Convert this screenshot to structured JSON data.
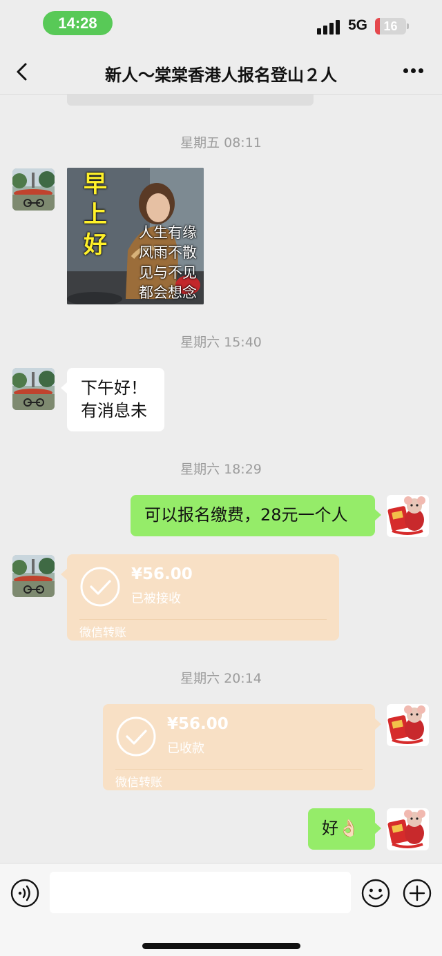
{
  "status_bar": {
    "time": "14:28",
    "network": "5G",
    "battery": "16",
    "battery_level": 0.16,
    "accent_color": "#58c957"
  },
  "nav": {
    "title": "新人～棠棠香港人报名登山２人",
    "back_icon": "chevron-left-icon",
    "more_icon": "more-dots-icon"
  },
  "messages": [
    {
      "type": "timestamp",
      "text": "星期五 08:11"
    },
    {
      "type": "sticker",
      "side": "left",
      "text_left": [
        "早",
        "上",
        "好"
      ],
      "text_right": [
        "人生有缘",
        "风雨不散",
        "见与不见",
        "都会想念"
      ]
    },
    {
      "type": "timestamp",
      "text": "星期六 15:40"
    },
    {
      "type": "text",
      "side": "left",
      "lines": [
        "下午好！",
        "有消息未"
      ]
    },
    {
      "type": "timestamp",
      "text": "星期六 18:29"
    },
    {
      "type": "text",
      "side": "right",
      "text": "可以报名缴费，28元一个人"
    },
    {
      "type": "transfer",
      "side": "left",
      "amount": "¥56.00",
      "status": "已被接收",
      "brand": "微信转账"
    },
    {
      "type": "timestamp",
      "text": "星期六 20:14"
    },
    {
      "type": "transfer",
      "side": "right",
      "amount": "¥56.00",
      "status": "已收款",
      "brand": "微信转账"
    },
    {
      "type": "text",
      "side": "right",
      "text": "好👌🏻"
    }
  ],
  "input_bar": {
    "placeholder": "",
    "voice_icon": "voice-icon",
    "emoji_icon": "emoji-icon",
    "plus_icon": "plus-icon"
  },
  "colors": {
    "background": "#ededed",
    "outgoing_bubble": "#95ec69",
    "incoming_bubble": "#ffffff",
    "transfer_card": "#f8e0c5"
  }
}
